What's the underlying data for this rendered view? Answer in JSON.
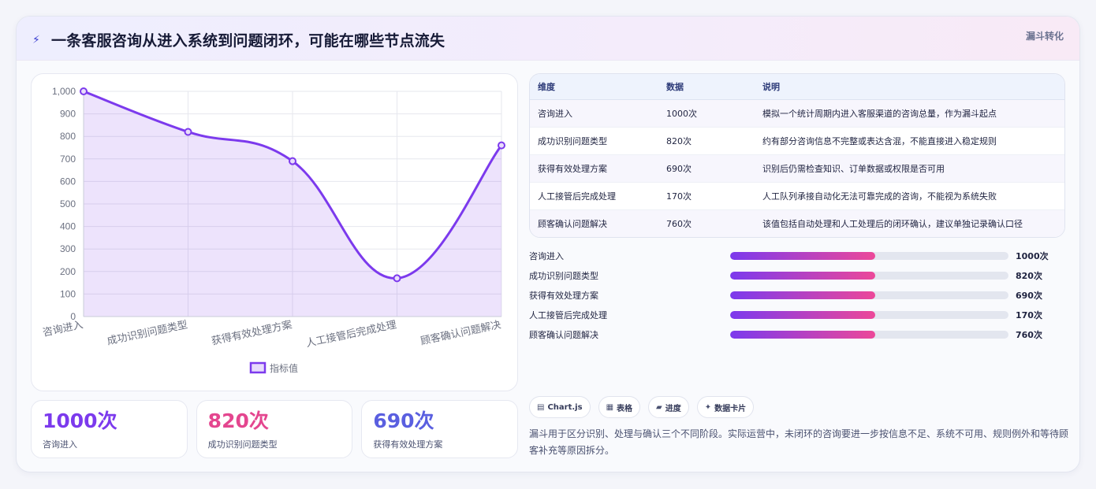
{
  "header": {
    "title": "一条客服咨询从进入系统到问题闭环，可能在哪些节点流失",
    "icon": "lightning-icon",
    "tag": "漏斗转化"
  },
  "chart_data": {
    "type": "line",
    "categories": [
      "咨询进入",
      "成功识别问题类型",
      "获得有效处理方案",
      "人工接管后完成处理",
      "顾客确认问题解决"
    ],
    "series": [
      {
        "name": "指标值",
        "values": [
          1000,
          820,
          690,
          170,
          760
        ],
        "color": "#7c3aed"
      }
    ],
    "ylim": [
      0,
      1000
    ],
    "yticks": [
      "0",
      "100",
      "200",
      "300",
      "400",
      "500",
      "600",
      "700",
      "800",
      "900",
      "1,000"
    ],
    "grid": true,
    "legend": "bottom",
    "fill": "area"
  },
  "kpis": [
    {
      "value": "1000次",
      "label": "咨询进入",
      "color": "#7c3aed"
    },
    {
      "value": "820次",
      "label": "成功识别问题类型",
      "color": "#e4468f"
    },
    {
      "value": "690次",
      "label": "获得有效处理方案",
      "color": "#5a5fe0"
    }
  ],
  "table": {
    "headers": [
      "维度",
      "数据",
      "说明"
    ],
    "rows": [
      [
        "咨询进入",
        "1000次",
        "模拟一个统计周期内进入客服渠道的咨询总量，作为漏斗起点"
      ],
      [
        "成功识别问题类型",
        "820次",
        "约有部分咨询信息不完整或表达含混，不能直接进入稳定规则"
      ],
      [
        "获得有效处理方案",
        "690次",
        "识别后仍需检查知识、订单数据或权限是否可用"
      ],
      [
        "人工接管后完成处理",
        "170次",
        "人工队列承接自动化无法可靠完成的咨询，不能视为系统失败"
      ],
      [
        "顾客确认问题解决",
        "760次",
        "该值包括自动处理和人工处理后的闭环确认，建议单独记录确认口径"
      ]
    ]
  },
  "progress": {
    "items": [
      {
        "label": "咨询进入",
        "value": "1000次",
        "fill_percent": 52
      },
      {
        "label": "成功识别问题类型",
        "value": "820次",
        "fill_percent": 52
      },
      {
        "label": "获得有效处理方案",
        "value": "690次",
        "fill_percent": 52
      },
      {
        "label": "人工接管后完成处理",
        "value": "170次",
        "fill_percent": 52
      },
      {
        "label": "顾客确认问题解决",
        "value": "760次",
        "fill_percent": 52
      }
    ]
  },
  "chips": [
    {
      "icon": "chart-icon",
      "glyph": "▤",
      "label": "Chart.js"
    },
    {
      "icon": "table-icon",
      "glyph": "▦",
      "label": "表格"
    },
    {
      "icon": "progress-icon",
      "glyph": "▰",
      "label": "进度"
    },
    {
      "icon": "sparkle-icon",
      "glyph": "✦",
      "label": "数据卡片"
    }
  ],
  "note": "漏斗用于区分识别、处理与确认三个不同阶段。实际运营中，未闭环的咨询要进一步按信息不足、系统不可用、规则例外和等待顾客补充等原因拆分。"
}
